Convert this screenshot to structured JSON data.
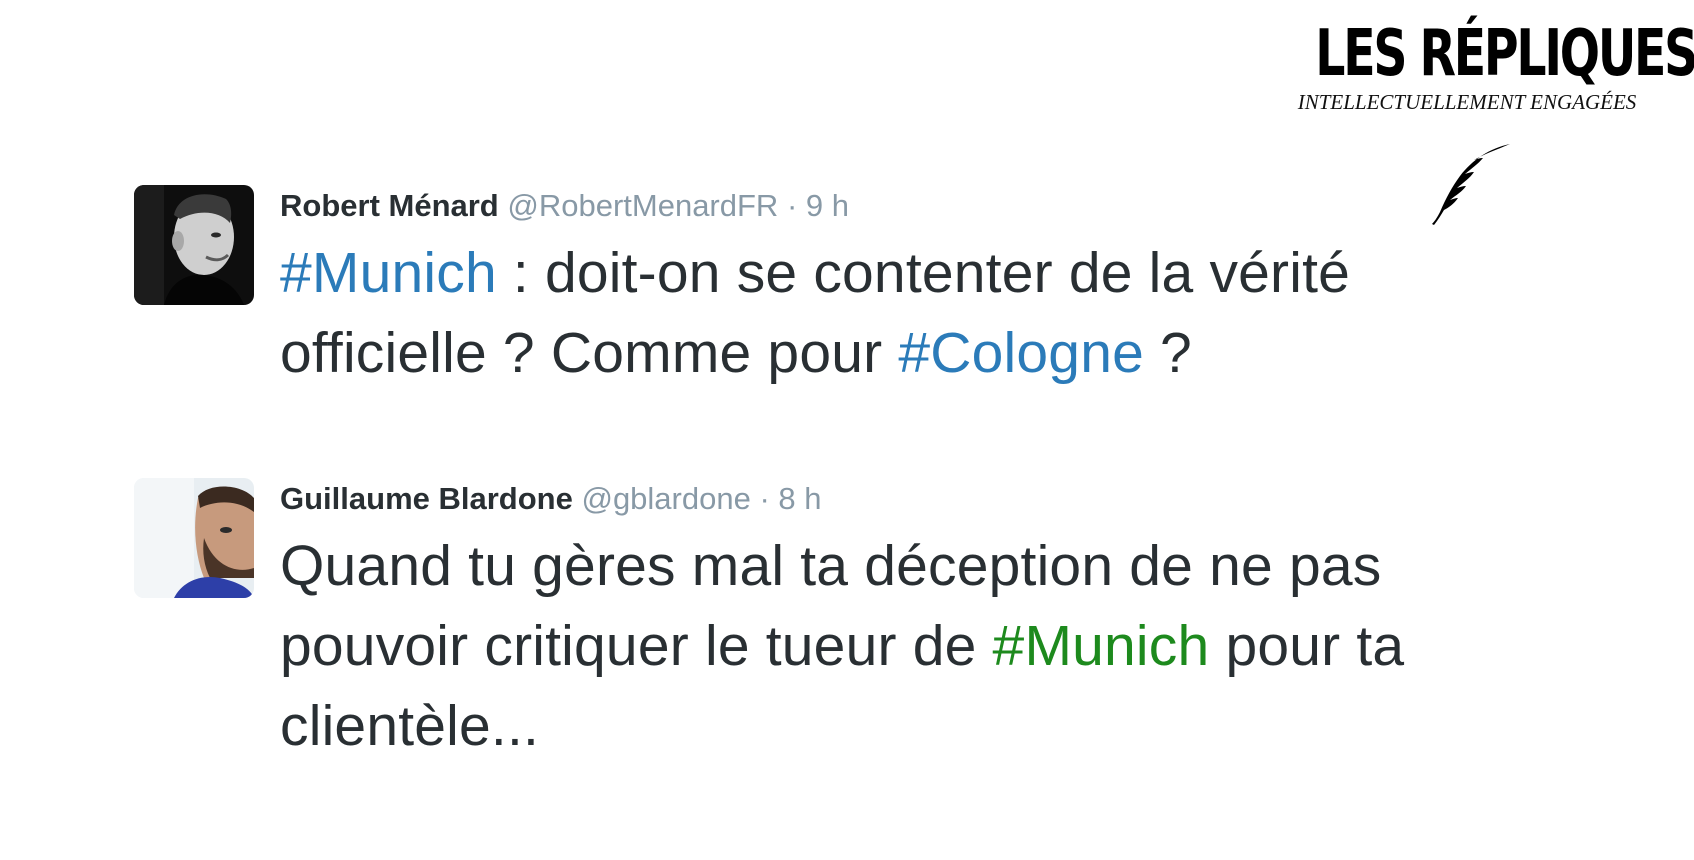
{
  "brand": {
    "title": "LES RÉPLIQUES",
    "tagline": "INTELLECTUELLEMENT ENGAGÉES",
    "icon": "feather-icon"
  },
  "tweets": [
    {
      "name": "Robert Ménard",
      "handle": "@RobertMenardFR",
      "separator": "·",
      "time": "9 h",
      "avatar_icon": "avatar-photo",
      "text": {
        "hashtag_1": "#Munich",
        "part_1": " : doit-on se contenter de la vérité officielle ? Comme pour ",
        "hashtag_2": "#Cologne",
        "part_2": " ?"
      }
    },
    {
      "name": "Guillaume Blardone",
      "handle": "@gblardone",
      "separator": "·",
      "time": "8 h",
      "avatar_icon": "avatar-photo",
      "text": {
        "part_1": "Quand tu gères mal ta déception de ne pas pouvoir critiquer le tueur de ",
        "hashtag_1": "#Munich",
        "part_2": " pour ta clientèle..."
      }
    }
  ],
  "colors": {
    "hashtag_blue": "#2b7bb9",
    "hashtag_green": "#1d8a1d",
    "muted": "#8899a6",
    "text": "#292f33"
  }
}
